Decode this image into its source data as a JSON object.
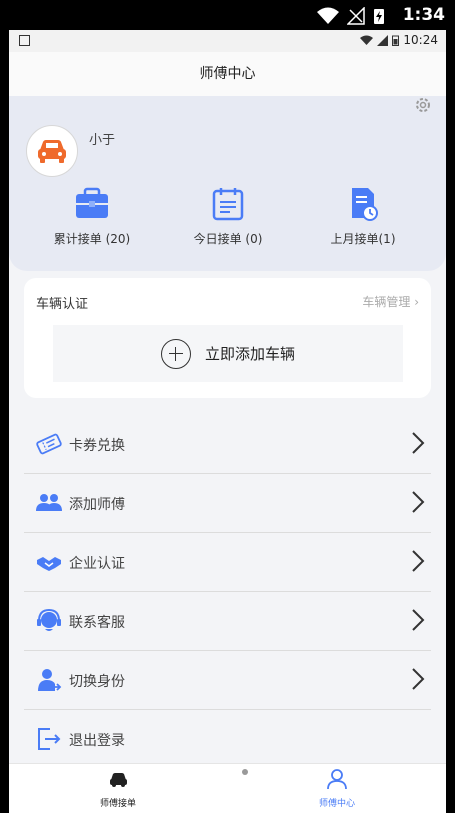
{
  "outer_status": {
    "time": "1:34"
  },
  "inner_status": {
    "time": "10:24"
  },
  "header": {
    "title": "师傅中心"
  },
  "profile": {
    "username": "小于",
    "stats": [
      {
        "label": "累计接单 (20)",
        "icon": "briefcase-icon"
      },
      {
        "label": "今日接单 (0)",
        "icon": "calendar-icon"
      },
      {
        "label": "上月接单(1)",
        "icon": "document-clock-icon"
      }
    ]
  },
  "vehicle": {
    "title": "车辆认证",
    "manage_label": "车辆管理",
    "add_label": "立即添加车辆"
  },
  "menu": [
    {
      "label": "卡券兑换",
      "icon": "coupon-icon"
    },
    {
      "label": "添加师傅",
      "icon": "users-icon"
    },
    {
      "label": "企业认证",
      "icon": "handshake-icon"
    },
    {
      "label": "联系客服",
      "icon": "headset-icon"
    },
    {
      "label": "切换身份",
      "icon": "switch-user-icon"
    },
    {
      "label": "退出登录",
      "icon": "logout-icon"
    }
  ],
  "bottom_nav": [
    {
      "label": "师傅接单",
      "icon": "car-icon"
    },
    {
      "label": "师傅中心",
      "icon": "person-icon"
    }
  ],
  "colors": {
    "accent": "#4a7cf6",
    "avatar_car": "#ef6a2c"
  }
}
